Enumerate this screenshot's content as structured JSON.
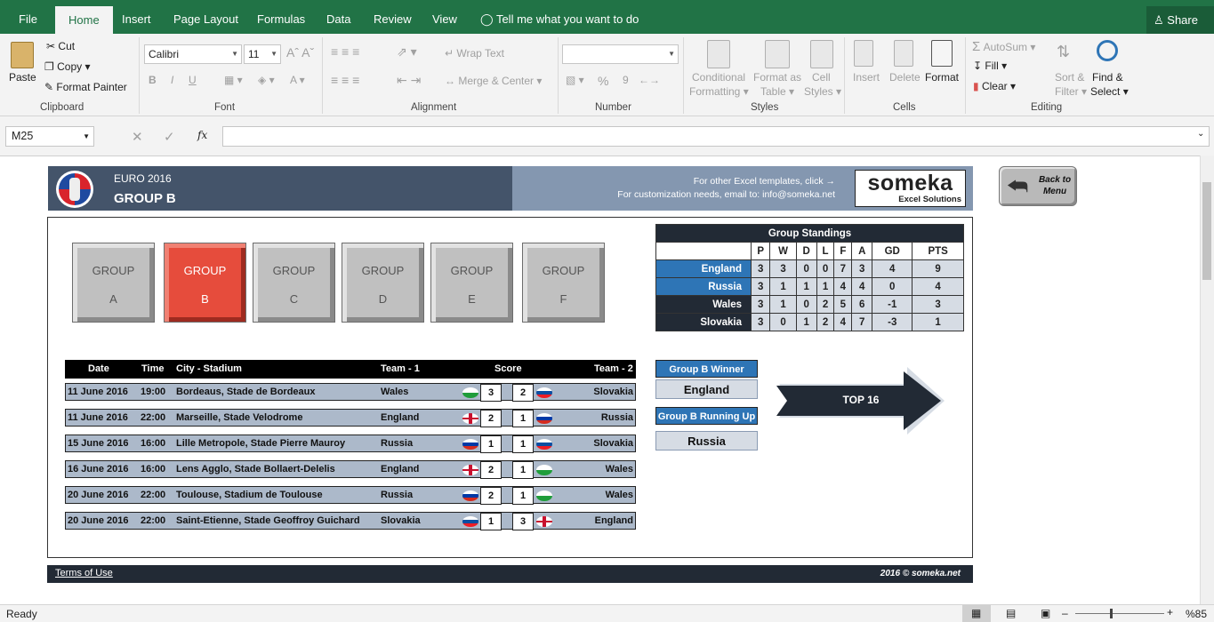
{
  "ribbon_tabs": [
    "File",
    "Home",
    "Insert",
    "Page Layout",
    "Formulas",
    "Data",
    "Review",
    "View"
  ],
  "tell_me": "Tell me what you want to do",
  "share": "Share",
  "clipboard": {
    "paste": "Paste",
    "cut": "Cut",
    "copy": "Copy",
    "format_painter": "Format Painter",
    "label": "Clipboard"
  },
  "font": {
    "name": "Calibri",
    "size": "11",
    "bold": "B",
    "italic": "I",
    "underline": "U",
    "label": "Font"
  },
  "alignment": {
    "wrap": "Wrap Text",
    "merge": "Merge & Center",
    "label": "Alignment"
  },
  "number": {
    "percent": "%",
    "comma": "9",
    "label": "Number"
  },
  "styles": {
    "conditional": "Conditional",
    "formatting": "Formatting",
    "format_as": "Format as",
    "table": "Table",
    "cell": "Cell",
    "cell_styles": "Styles",
    "label": "Styles"
  },
  "cells": {
    "insert": "Insert",
    "delete": "Delete",
    "format": "Format",
    "label": "Cells"
  },
  "editing": {
    "autosum": "AutoSum",
    "fill": "Fill",
    "clear": "Clear",
    "sort": "Sort &",
    "filter": "Filter",
    "find": "Find &",
    "select": "Select",
    "label": "Editing"
  },
  "formula_bar": {
    "name_box": "M25",
    "fx": "fx",
    "value": ""
  },
  "header": {
    "event": "EURO 2016",
    "group": "GROUP B",
    "templates_line": "For other Excel templates, click →",
    "email_line": "For customization needs, email to: info@someka.net",
    "logo_main": "someka",
    "logo_sub": "Excel Solutions",
    "back_btn": "Back to Menu"
  },
  "group_buttons": [
    {
      "l1": "GROUP",
      "l2": "A",
      "active": false
    },
    {
      "l1": "GROUP",
      "l2": "B",
      "active": true
    },
    {
      "l1": "GROUP",
      "l2": "C",
      "active": false
    },
    {
      "l1": "GROUP",
      "l2": "D",
      "active": false
    },
    {
      "l1": "GROUP",
      "l2": "E",
      "active": false
    },
    {
      "l1": "GROUP",
      "l2": "F",
      "active": false
    }
  ],
  "standings": {
    "title": "Group Standings",
    "columns": [
      "P",
      "W",
      "D",
      "L",
      "F",
      "A",
      "GD",
      "PTS"
    ],
    "rows": [
      {
        "team": "England",
        "qualified": true,
        "values": [
          "3",
          "3",
          "0",
          "0",
          "7",
          "3",
          "4",
          "9"
        ]
      },
      {
        "team": "Russia",
        "qualified": true,
        "values": [
          "3",
          "1",
          "1",
          "1",
          "4",
          "4",
          "0",
          "4"
        ]
      },
      {
        "team": "Wales",
        "qualified": false,
        "values": [
          "3",
          "1",
          "0",
          "2",
          "5",
          "6",
          "-1",
          "3"
        ]
      },
      {
        "team": "Slovakia",
        "qualified": false,
        "values": [
          "3",
          "0",
          "1",
          "2",
          "4",
          "7",
          "-3",
          "1"
        ]
      }
    ]
  },
  "fixtures": {
    "headers": {
      "date": "Date",
      "time": "Time",
      "city": "City - Stadium",
      "team1": "Team - 1",
      "score": "Score",
      "team2": "Team - 2"
    },
    "matches": [
      {
        "date": "11 June 2016",
        "time": "19:00",
        "city": "Bordeaus, Stade de Bordeaux",
        "team1": "Wales",
        "flag1": "wales",
        "s1": "3",
        "s2": "2",
        "flag2": "slovakia",
        "team2": "Slovakia"
      },
      {
        "date": "11 June 2016",
        "time": "22:00",
        "city": "Marseille, Stade Velodrome",
        "team1": "England",
        "flag1": "england",
        "s1": "2",
        "s2": "1",
        "flag2": "russia",
        "team2": "Russia"
      },
      {
        "date": "15 June 2016",
        "time": "16:00",
        "city": "Lille Metropole, Stade Pierre Mauroy",
        "team1": "Russia",
        "flag1": "russia",
        "s1": "1",
        "s2": "1",
        "flag2": "slovakia",
        "team2": "Slovakia"
      },
      {
        "date": "16 June 2016",
        "time": "16:00",
        "city": "Lens Agglo, Stade Bollaert-Delelis",
        "team1": "England",
        "flag1": "england",
        "s1": "2",
        "s2": "1",
        "flag2": "wales",
        "team2": "Wales"
      },
      {
        "date": "20 June 2016",
        "time": "22:00",
        "city": "Toulouse, Stadium de Toulouse",
        "team1": "Russia",
        "flag1": "russia",
        "s1": "2",
        "s2": "1",
        "flag2": "wales",
        "team2": "Wales"
      },
      {
        "date": "20 June 2016",
        "time": "22:00",
        "city": "Saint-Etienne, Stade Geoffroy Guichard",
        "team1": "Slovakia",
        "flag1": "slovakia",
        "s1": "1",
        "s2": "3",
        "flag2": "england",
        "team2": "England"
      }
    ]
  },
  "winner": {
    "label": "Group B Winner",
    "team": "England"
  },
  "runner_up": {
    "label": "Group B Running Up",
    "team": "Russia"
  },
  "top16": "TOP 16",
  "footer": {
    "terms": "Terms of Use",
    "copyright": "2016 © someka.net"
  },
  "status": {
    "ready": "Ready",
    "zoom": "%85"
  },
  "colors": {
    "excel_green": "#217346",
    "navy": "#222a35",
    "blue": "#2e75b6",
    "active_red": "#e64c3c",
    "header_slate": "#44546a"
  }
}
